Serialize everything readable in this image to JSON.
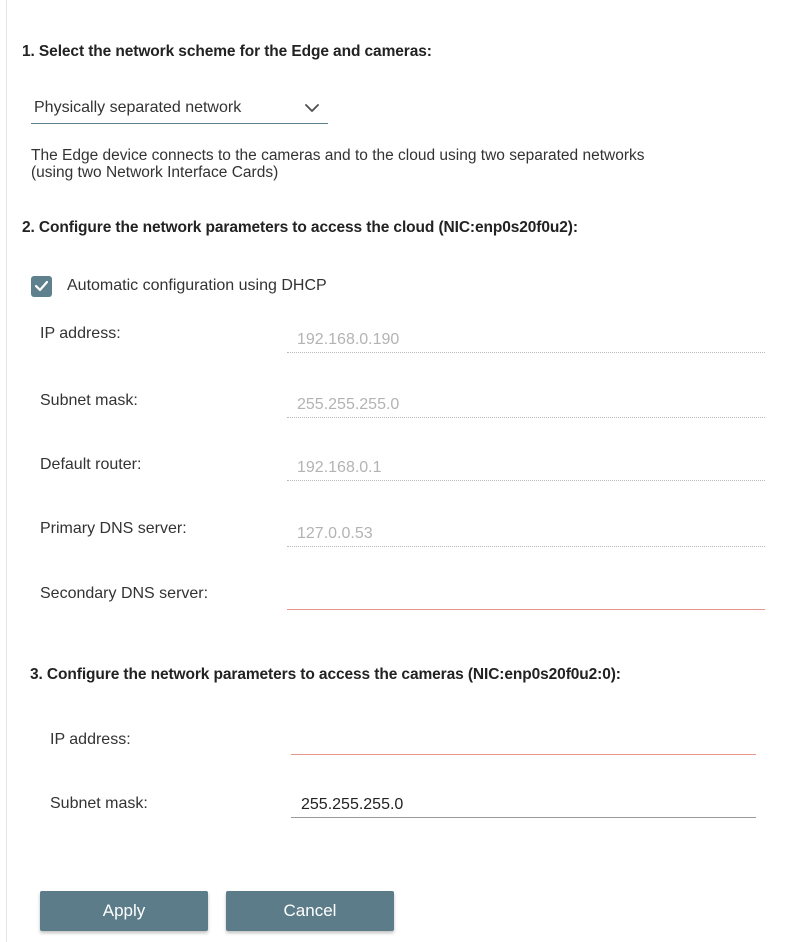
{
  "section1": {
    "title": "1. Select the network scheme for the Edge and cameras:",
    "scheme_select": {
      "selected": "Physically separated network",
      "icon": "chevron-down-icon"
    },
    "description_line1": "The Edge device connects to the cameras and to the cloud using two separated networks",
    "description_line2": "(using two Network Interface Cards)"
  },
  "section2": {
    "title": "2. Configure the network parameters to access the cloud (NIC:enp0s20f0u2):",
    "dhcp": {
      "label": "Automatic configuration using DHCP",
      "checked": true
    },
    "fields": {
      "ip_address": {
        "label": "IP address:",
        "value": "192.168.0.190",
        "state": "disabled"
      },
      "subnet_mask": {
        "label": "Subnet mask:",
        "value": "255.255.255.0",
        "state": "disabled"
      },
      "default_router": {
        "label": "Default router:",
        "value": "192.168.0.1",
        "state": "disabled"
      },
      "primary_dns": {
        "label": "Primary DNS server:",
        "value": "127.0.0.53",
        "state": "disabled"
      },
      "secondary_dns": {
        "label": "Secondary DNS server:",
        "value": "",
        "state": "error"
      }
    }
  },
  "section3": {
    "title": "3. Configure the network parameters to access the cameras (NIC:enp0s20f0u2:0):",
    "fields": {
      "ip_address": {
        "label": "IP address:",
        "value": "",
        "state": "error"
      },
      "subnet_mask": {
        "label": "Subnet mask:",
        "value": "255.255.255.0",
        "state": "active"
      }
    }
  },
  "actions": {
    "apply_label": "Apply",
    "cancel_label": "Cancel"
  },
  "colors": {
    "accent": "#5c7c89",
    "error_underline": "#e8958f",
    "disabled_text": "#b3b3b3"
  }
}
